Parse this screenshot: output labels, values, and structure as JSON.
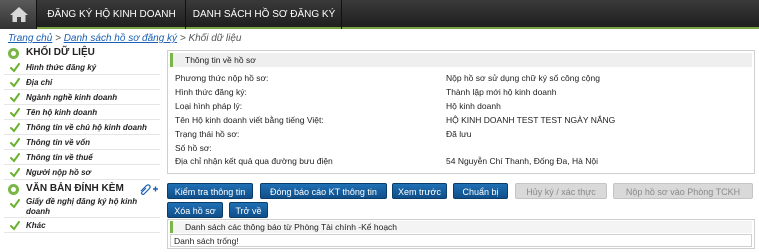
{
  "topnav": {
    "tabs": [
      {
        "label": "ĐĂNG KÝ HỘ KINH DOANH"
      },
      {
        "label": "DANH SÁCH HỒ SƠ ĐĂNG KÝ"
      }
    ]
  },
  "breadcrumb": {
    "home": "Trang chủ",
    "sep1": " > ",
    "list": "Danh sách hồ sơ đăng ký",
    "sep2": " > ",
    "current": "Khối dữ liệu"
  },
  "sidebar": {
    "data_section": "KHỐI DỮ LIỆU",
    "data_items": [
      {
        "label": "Hình thức đăng ký"
      },
      {
        "label": "Địa chỉ"
      },
      {
        "label": "Ngành nghề kinh doanh"
      },
      {
        "label": "Tên hộ kinh doanh"
      },
      {
        "label": "Thông tin về chủ hộ kinh doanh"
      },
      {
        "label": "Thông tin về vốn"
      },
      {
        "label": "Thông tin về thuế"
      },
      {
        "label": "Người nộp hồ sơ"
      }
    ],
    "attach_section": "VĂN BẢN ĐÍNH KÈM",
    "attach_items": [
      {
        "label": "Giấy đề nghị đăng ký hộ kinh doanh"
      },
      {
        "label": "Khác"
      }
    ]
  },
  "info": {
    "title": "Thông tin về hồ sơ",
    "rows": [
      {
        "label": "Phương thức nộp hồ sơ:",
        "value": "Nộp hồ sơ sử dụng chữ ký số công cộng"
      },
      {
        "label": "Hình thức đăng ký:",
        "value": "Thành lập mới hộ kinh doanh"
      },
      {
        "label": "Loại hình pháp lý:",
        "value": "Hộ kinh doanh"
      },
      {
        "label": "Tên Hộ kinh doanh viết bằng tiếng Việt:",
        "value": "HỘ KINH DOANH TEST TEST NGÀY NẮNG"
      },
      {
        "label": "Trạng thái hồ sơ:",
        "value": "Đã lưu"
      },
      {
        "label": "Số hồ sơ:",
        "value": ""
      },
      {
        "label": "Địa chỉ nhận kết quả qua đường bưu điện",
        "value": "54 Nguyễn Chí Thanh, Đống Đa, Hà Nội"
      }
    ]
  },
  "buttons": {
    "check": "Kiểm tra thông tin",
    "report": "Đóng báo cáo KT thông tin",
    "preview": "Xem trước",
    "prepare": "Chuẩn bị",
    "cancel_sign": "Hủy ký / xác thực",
    "submit": "Nộp hồ sơ vào Phòng TCKH",
    "delete": "Xóa hồ sơ",
    "back": "Trở về"
  },
  "notifications": {
    "title": "Danh sách các thông báo từ Phòng Tài chính -Kế hoạch",
    "empty": "Danh sách trống!"
  },
  "colors": {
    "nav_bg": "#2b2b2b",
    "accent_green": "#7ab648",
    "button_blue": "#1a5fa0",
    "link_blue": "#1a5fb4"
  }
}
